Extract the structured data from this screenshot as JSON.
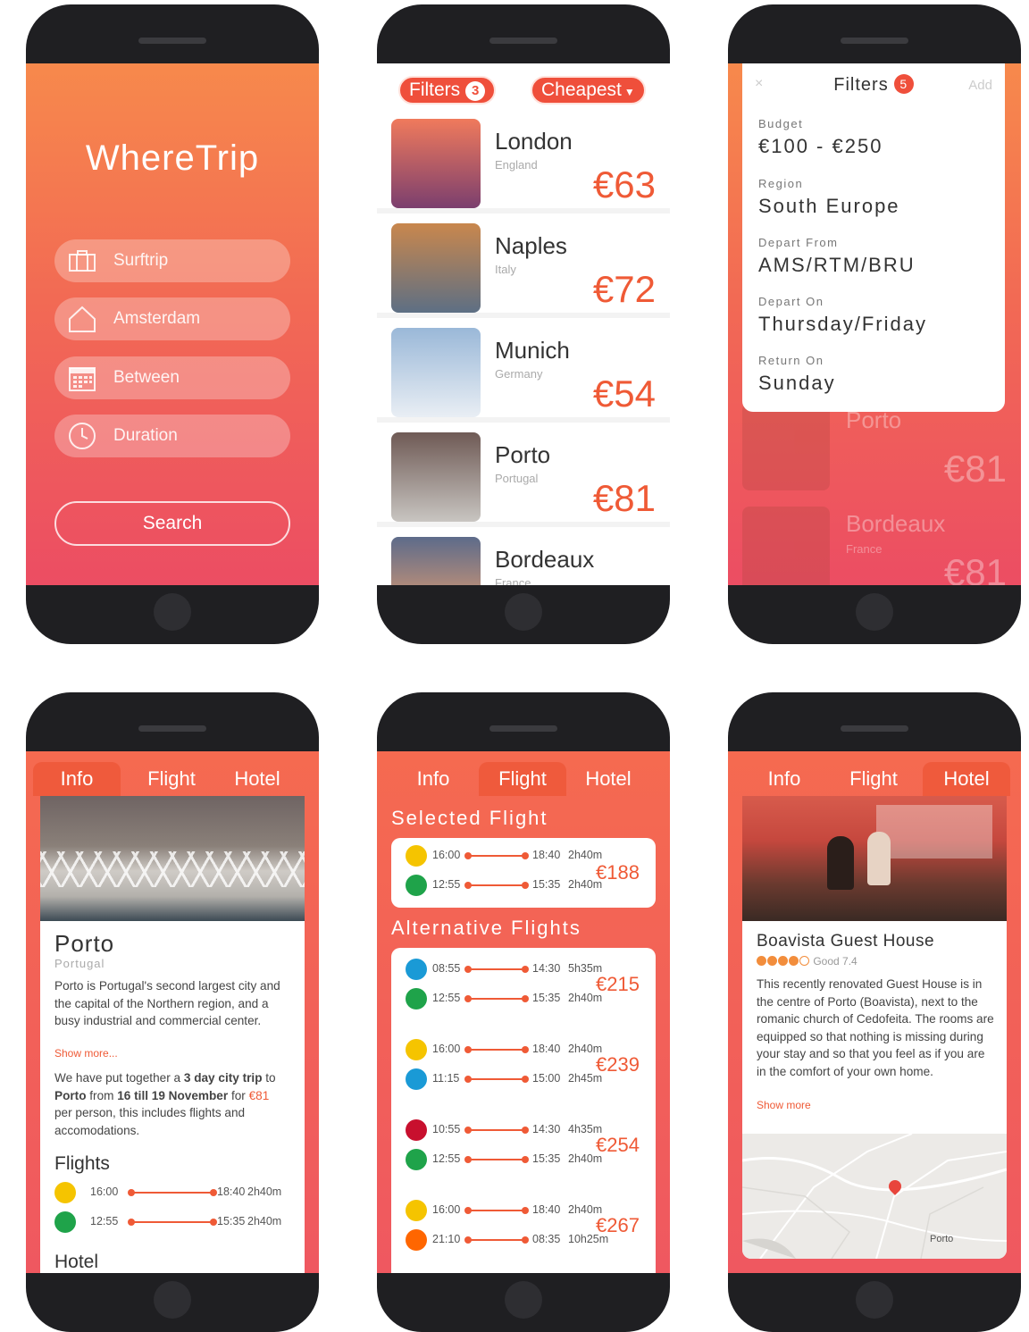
{
  "home": {
    "logo": "WhereTrip",
    "fields": [
      {
        "icon": "suitcase-icon",
        "label": "Surftrip"
      },
      {
        "icon": "home-icon",
        "label": "Amsterdam"
      },
      {
        "icon": "calendar-icon",
        "label": "Between"
      },
      {
        "icon": "clock-icon",
        "label": "Duration"
      }
    ],
    "search_label": "Search"
  },
  "results": {
    "filters_label": "Filters",
    "filters_count": "3",
    "sort_label": "Cheapest",
    "cities": [
      {
        "name": "London",
        "country": "England",
        "price": "€63",
        "colors": [
          "#f07a5c",
          "#7b3f6e"
        ]
      },
      {
        "name": "Naples",
        "country": "Italy",
        "price": "€72",
        "colors": [
          "#c9874d",
          "#5d6f84"
        ]
      },
      {
        "name": "Munich",
        "country": "Germany",
        "price": "€54",
        "colors": [
          "#9ab8d8",
          "#e9eef4"
        ]
      },
      {
        "name": "Porto",
        "country": "Portugal",
        "price": "€81",
        "colors": [
          "#6f5a55",
          "#c8c5c1"
        ]
      },
      {
        "name": "Bordeaux",
        "country": "France",
        "price": "",
        "colors": [
          "#5d6b8a",
          "#f1a36f"
        ]
      }
    ]
  },
  "filters": {
    "close_icon": "close-icon",
    "close_glyph": "×",
    "title": "Filters",
    "count": "5",
    "add_label": "Add",
    "items": [
      {
        "label": "Budget",
        "value": "€100 - €250"
      },
      {
        "label": "Region",
        "value": "South Europe"
      },
      {
        "label": "Depart From",
        "value": "AMS/RTM/BRU"
      },
      {
        "label": "Depart On",
        "value": "Thursday/Friday"
      },
      {
        "label": "Return On",
        "value": "Sunday"
      }
    ],
    "behind": [
      {
        "name": "Porto",
        "price": "€81"
      },
      {
        "name": "Bordeaux",
        "country": "France",
        "price": "€81"
      }
    ]
  },
  "tabs": {
    "info": "Info",
    "flight": "Flight",
    "hotel": "Hotel"
  },
  "info": {
    "city": "Porto",
    "country": "Portugal",
    "description": "Porto is Portugal's second largest city and the capital of the Northern region, and a busy industrial and commercial center.",
    "show_more": "Show more...",
    "trip_prefix": "We have put together a ",
    "trip_days": "3 day city trip",
    "trip_to": " to ",
    "trip_city": "Porto",
    "trip_from": " from ",
    "trip_dates": "16 till 19 November",
    "trip_for": " for ",
    "trip_price": "€81",
    "trip_suffix": " per person, this includes flights and accomodations.",
    "flights_heading": "Flights",
    "flights": [
      {
        "airline": "vueling",
        "color": "#f5c400",
        "dep": "16:00",
        "arr": "18:40",
        "dur": "2h40m"
      },
      {
        "airline": "transavia",
        "color": "#1fa34a",
        "dep": "12:55",
        "arr": "15:35",
        "dur": "2h40m"
      }
    ],
    "hotel_heading": "Hotel"
  },
  "flight_tab": {
    "selected_heading": "Selected Flight",
    "selected": {
      "price": "€188",
      "legs": [
        {
          "airline": "vueling",
          "color": "#f5c400",
          "dep": "16:00",
          "arr": "18:40",
          "dur": "2h40m"
        },
        {
          "airline": "transavia",
          "color": "#1fa34a",
          "dep": "12:55",
          "arr": "15:35",
          "dur": "2h40m"
        }
      ]
    },
    "alt_heading": "Alternative Flights",
    "alternatives": [
      {
        "price": "€215",
        "legs": [
          {
            "airline": "KLM",
            "color": "#1a9ad6",
            "dep": "08:55",
            "arr": "14:30",
            "dur": "5h35m"
          },
          {
            "airline": "transavia",
            "color": "#1fa34a",
            "dep": "12:55",
            "arr": "15:35",
            "dur": "2h40m"
          }
        ]
      },
      {
        "price": "€239",
        "legs": [
          {
            "airline": "vueling",
            "color": "#f5c400",
            "dep": "16:00",
            "arr": "18:40",
            "dur": "2h40m"
          },
          {
            "airline": "KLM",
            "color": "#1a9ad6",
            "dep": "11:15",
            "arr": "15:00",
            "dur": "2h45m"
          }
        ]
      },
      {
        "price": "€254",
        "legs": [
          {
            "airline": "british-airways",
            "color": "#c8102e",
            "dep": "10:55",
            "arr": "14:30",
            "dur": "4h35m"
          },
          {
            "airline": "transavia",
            "color": "#1fa34a",
            "dep": "12:55",
            "arr": "15:35",
            "dur": "2h40m"
          }
        ]
      },
      {
        "price": "€267",
        "legs": [
          {
            "airline": "vueling",
            "color": "#f5c400",
            "dep": "16:00",
            "arr": "18:40",
            "dur": "2h40m"
          },
          {
            "airline": "easyjet",
            "color": "#ff6600",
            "dep": "21:10",
            "arr": "08:35",
            "dur": "10h25m"
          }
        ]
      }
    ]
  },
  "hotel_tab": {
    "name": "Boavista Guest House",
    "rating_dots": 4,
    "rating_total": 5,
    "rating_text": "Good 7.4",
    "description": "This recently renovated Guest House is in the centre of Porto (Boavista), next to the romanic church of Cedofeita. The rooms are equipped so that nothing is missing during your stay and so that you feel as if you are in the comfort of your own home.",
    "show_more": "Show more",
    "map_label": "Porto",
    "map_pin": "location-pin-icon"
  },
  "colors": {
    "accent": "#ef5a36",
    "gradient_top": "#f7894c",
    "gradient_bottom": "#ec4d63"
  }
}
